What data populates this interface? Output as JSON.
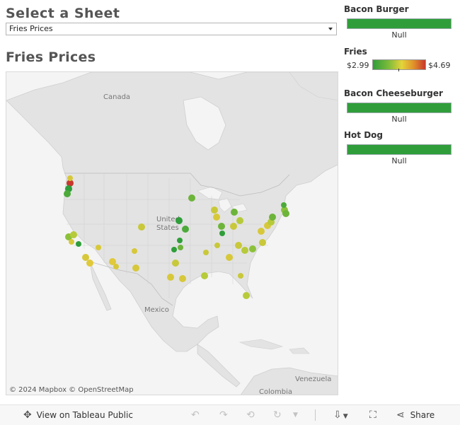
{
  "header": {
    "sheet_selector_title": "Select a Sheet",
    "sheet_selector_value": "Fries Prices"
  },
  "viz": {
    "title": "Fries Prices",
    "map_labels": {
      "canada": "Canada",
      "united": "United",
      "states": "States",
      "mexico": "Mexico",
      "venezuela": "Venezuela",
      "colombia": "Colombia"
    },
    "attribution": "© 2024 Mapbox  © OpenStreetMap"
  },
  "legends": {
    "bacon_burger": {
      "title": "Bacon Burger",
      "null_label": "Null",
      "color": "#2f9e3a"
    },
    "fries": {
      "title": "Fries",
      "min_label": "$2.99",
      "max_label": "$4.69",
      "colors": [
        "#2f9e3a",
        "#e4d43a",
        "#c8382e"
      ]
    },
    "bacon_cheeseburger": {
      "title": "Bacon Cheeseburger",
      "null_label": "Null",
      "color": "#2f9e3a"
    },
    "hot_dog": {
      "title": "Hot Dog",
      "null_label": "Null",
      "color": "#2f9e3a"
    }
  },
  "toolbar": {
    "view_on_public": "View on Tableau Public",
    "share": "Share",
    "icons": [
      "tableau-icon",
      "undo-icon",
      "redo-icon",
      "revert-icon",
      "refresh-icon",
      "download-icon",
      "fullscreen-icon",
      "share-icon"
    ]
  }
}
